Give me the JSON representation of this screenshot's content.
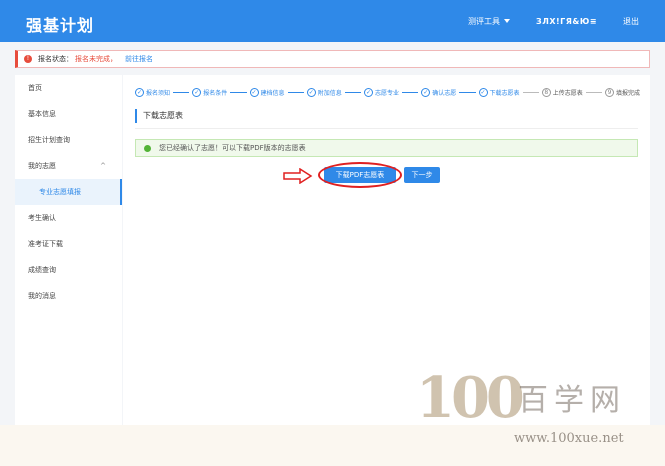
{
  "header": {
    "brand": "强基计划",
    "nav": {
      "tools_label": "测评工具",
      "user_label": "ЗЛХ!ГЯ&Ю≡",
      "logout_label": "退出"
    }
  },
  "status": {
    "label": "报名状态：",
    "value": "报名未完成，",
    "link": "前往报名"
  },
  "sidebar": {
    "items": [
      {
        "label": "首页"
      },
      {
        "label": "基本信息"
      },
      {
        "label": "招生计划查询"
      },
      {
        "label": "我的志愿"
      },
      {
        "label": "专业志愿填报"
      },
      {
        "label": "考生确认"
      },
      {
        "label": "准考证下载"
      },
      {
        "label": "成绩查询"
      },
      {
        "label": "我的消息"
      }
    ]
  },
  "steps": [
    {
      "label": "报名须知",
      "state": "done"
    },
    {
      "label": "报名条件",
      "state": "done"
    },
    {
      "label": "建档信息",
      "state": "done"
    },
    {
      "label": "附加信息",
      "state": "done"
    },
    {
      "label": "志愿专业",
      "state": "done"
    },
    {
      "label": "确认志愿",
      "state": "done"
    },
    {
      "label": "下载志愿表",
      "state": "done"
    },
    {
      "label": "上传志愿表",
      "state": "pending",
      "num": "8"
    },
    {
      "label": "填报完成",
      "state": "pending",
      "num": "9"
    }
  ],
  "step_check": "✓",
  "main": {
    "title": "下载志愿表",
    "notice": "您已经确认了志愿！可以下载PDF版本的志愿表",
    "download_button": "下载PDF志愿表",
    "next_button": "下一步"
  },
  "watermark": {
    "number": "100",
    "name": "百学网",
    "url": "www.100xue.net"
  },
  "colors": {
    "primary": "#2f89e8",
    "danger": "#e74c3c",
    "success": "#52b336"
  }
}
